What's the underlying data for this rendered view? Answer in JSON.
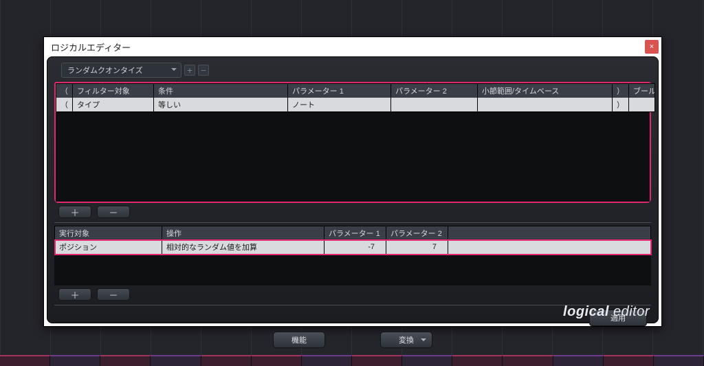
{
  "window": {
    "title": "ロジカルエディター",
    "close_glyph": "×"
  },
  "preset": {
    "name": "ランダムクオンタイズ",
    "save_glyph": "＋",
    "del_glyph": "－"
  },
  "filter": {
    "headers": {
      "open": "（",
      "target": "フィルター対象",
      "cond": "条件",
      "p1": "パラメーター 1",
      "p2": "パラメーター 2",
      "range": "小節範囲/タイムベース",
      "close": "）",
      "bool": "ブール"
    },
    "row": {
      "open": "（",
      "target": "タイプ",
      "cond": "等しい",
      "p1": "ノート",
      "p2": "",
      "range": "",
      "close": "）",
      "bool": ""
    }
  },
  "action": {
    "headers": {
      "target": "実行対象",
      "op": "操作",
      "p1": "パラメーター 1",
      "p2": "パラメーター 2"
    },
    "row": {
      "target": "ポジション",
      "op": "相対的なランダム値を加算",
      "p1": "-7",
      "p2": "7"
    }
  },
  "buttons": {
    "add": "＋",
    "remove": "－",
    "apply": "適用",
    "function": "機能",
    "transform": "変換"
  },
  "brand": {
    "a": "logical",
    "b": "editor"
  }
}
